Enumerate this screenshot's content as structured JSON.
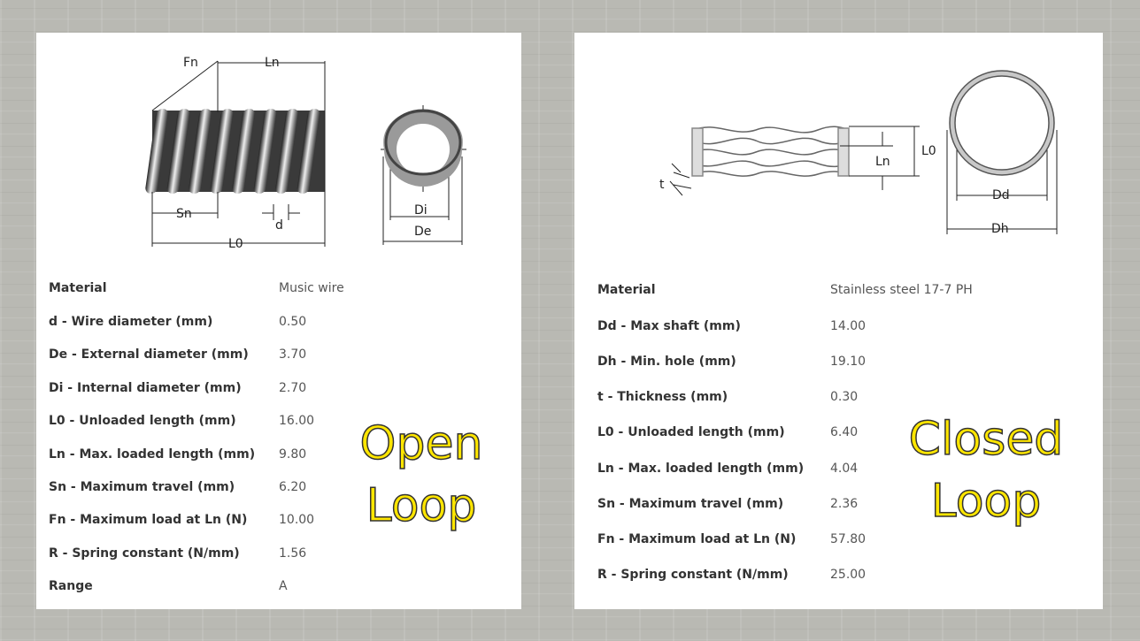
{
  "open_loop": {
    "diagram_labels": {
      "fn": "Fn",
      "ln": "Ln",
      "sn": "Sn",
      "d": "d",
      "l0": "L0",
      "di": "Di",
      "de": "De"
    },
    "specs": [
      {
        "label": "Material",
        "value": "Music wire"
      },
      {
        "label": "d - Wire diameter (mm)",
        "value": "0.50"
      },
      {
        "label": "De - External diameter (mm)",
        "value": "3.70"
      },
      {
        "label": "Di - Internal diameter (mm)",
        "value": "2.70"
      },
      {
        "label": "L0 - Unloaded length (mm)",
        "value": "16.00"
      },
      {
        "label": "Ln - Max. loaded length (mm)",
        "value": "9.80"
      },
      {
        "label": "Sn - Maximum travel (mm)",
        "value": "6.20"
      },
      {
        "label": "Fn - Maximum load at Ln (N)",
        "value": "10.00"
      },
      {
        "label": "R - Spring constant (N/mm)",
        "value": "1.56"
      },
      {
        "label": "Range",
        "value": "A"
      }
    ],
    "overlay": {
      "line1": "Open",
      "line2": "Loop"
    }
  },
  "closed_loop": {
    "diagram_labels": {
      "t": "t",
      "ln": "Ln",
      "l0": "L0",
      "dd": "Dd",
      "dh": "Dh"
    },
    "specs": [
      {
        "label": "Material",
        "value": "Stainless steel 17-7 PH"
      },
      {
        "label": "Dd - Max shaft (mm)",
        "value": "14.00"
      },
      {
        "label": "Dh - Min. hole (mm)",
        "value": "19.10"
      },
      {
        "label": "t - Thickness (mm)",
        "value": "0.30"
      },
      {
        "label": "L0 - Unloaded length (mm)",
        "value": "6.40"
      },
      {
        "label": "Ln - Max. loaded length (mm)",
        "value": "4.04"
      },
      {
        "label": "Sn - Maximum travel (mm)",
        "value": "2.36"
      },
      {
        "label": "Fn - Maximum load at Ln (N)",
        "value": "57.80"
      },
      {
        "label": "R - Spring constant (N/mm)",
        "value": "25.00"
      }
    ],
    "overlay": {
      "line1": "Closed",
      "line2": "Loop"
    }
  },
  "colors": {
    "overlay_fill": "#ffe600",
    "overlay_outline": "#333333",
    "panel_bg": "#ffffff",
    "page_bg": "#b9b9b3"
  }
}
